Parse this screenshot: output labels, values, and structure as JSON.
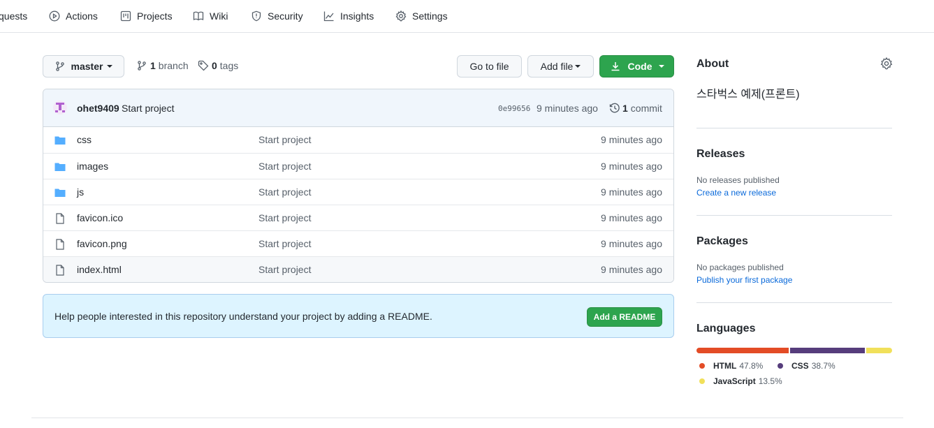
{
  "nav": {
    "tabs": [
      {
        "label": "quests",
        "icon": "pull-request-icon"
      },
      {
        "label": "Actions",
        "icon": "play-icon"
      },
      {
        "label": "Projects",
        "icon": "project-icon"
      },
      {
        "label": "Wiki",
        "icon": "book-icon"
      },
      {
        "label": "Security",
        "icon": "shield-icon"
      },
      {
        "label": "Insights",
        "icon": "graph-icon"
      },
      {
        "label": "Settings",
        "icon": "gear-icon"
      }
    ]
  },
  "branchbar": {
    "branch": "master",
    "branch_count": "1",
    "branch_label": "branch",
    "tag_count": "0",
    "tag_label": "tags",
    "go_to_file": "Go to file",
    "add_file": "Add file",
    "code": "Code"
  },
  "commit": {
    "author": "ohet9409",
    "message": "Start project",
    "hash": "0e99656",
    "time": "9 minutes ago",
    "count": "1",
    "count_label": "commit"
  },
  "files": [
    {
      "type": "dir",
      "name": "css",
      "message": "Start project",
      "time": "9 minutes ago"
    },
    {
      "type": "dir",
      "name": "images",
      "message": "Start project",
      "time": "9 minutes ago"
    },
    {
      "type": "dir",
      "name": "js",
      "message": "Start project",
      "time": "9 minutes ago"
    },
    {
      "type": "file",
      "name": "favicon.ico",
      "message": "Start project",
      "time": "9 minutes ago"
    },
    {
      "type": "file",
      "name": "favicon.png",
      "message": "Start project",
      "time": "9 minutes ago"
    },
    {
      "type": "file",
      "name": "index.html",
      "message": "Start project",
      "time": "9 minutes ago"
    }
  ],
  "readme": {
    "text": "Help people interested in this repository understand your project by adding a README.",
    "button": "Add a README"
  },
  "sidebar": {
    "about_title": "About",
    "description": "스타벅스 예제(프론트)",
    "releases_title": "Releases",
    "releases_none": "No releases published",
    "releases_link": "Create a new release",
    "packages_title": "Packages",
    "packages_none": "No packages published",
    "packages_link": "Publish your first package",
    "languages_title": "Languages",
    "languages": [
      {
        "name": "HTML",
        "percent": "47.8%",
        "value": 47.8,
        "color": "#e34c26"
      },
      {
        "name": "CSS",
        "percent": "38.7%",
        "value": 38.7,
        "color": "#563d7c"
      },
      {
        "name": "JavaScript",
        "percent": "13.5%",
        "value": 13.5,
        "color": "#f1e05a"
      }
    ]
  },
  "colors": {
    "accent_green": "#2da44e",
    "link_blue": "#0969da",
    "folder_blue": "#54aeff"
  }
}
